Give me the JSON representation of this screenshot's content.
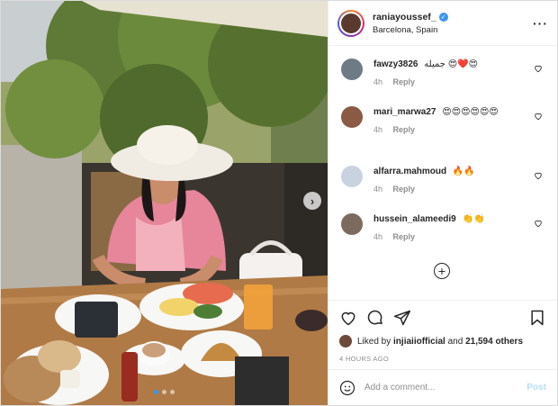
{
  "post": {
    "username": "raniayoussef_",
    "verified_icon": "verified-badge-icon",
    "location": "Barcelona, Spain",
    "more_icon": "more-options-icon",
    "avatar_color": "#5a3a2e"
  },
  "photo": {
    "description_icon": "post-photo",
    "next_icon": "chevron-right-icon",
    "carousel_count": 3,
    "carousel_active": 0
  },
  "comments": [
    {
      "user": "fawzy3826",
      "text": "جميله 😍❤️😍",
      "time": "4h",
      "reply": "Reply",
      "avatar_color": "#6e7a86"
    },
    {
      "user": "mari_marwa27",
      "text": "😍😍😍😍😍😍",
      "time": "4h",
      "reply": "Reply",
      "avatar_color": "#8a5a44"
    },
    {
      "user": "alfarra.mahmoud",
      "text": "🔥🔥",
      "time": "4h",
      "reply": "Reply",
      "avatar_color": "#c9d3df"
    },
    {
      "user": "hussein_alameedi9",
      "text": "👏👏",
      "time": "4h",
      "reply": "Reply",
      "avatar_color": "#7d6a5e"
    }
  ],
  "load_more_icon": "plus-circle-icon",
  "actions": {
    "like_icon": "heart-icon",
    "comment_icon": "comment-bubble-icon",
    "share_icon": "paper-plane-icon",
    "save_icon": "bookmark-icon"
  },
  "likes": {
    "prefix": "Liked by",
    "user": "injiaiiofficial",
    "conj": "and",
    "count": "21,594 others"
  },
  "time_ago": "4 HOURS AGO",
  "add_comment": {
    "placeholder": "Add a comment...",
    "post_label": "Post",
    "emoji_icon": "smiley-icon"
  },
  "colors": {
    "accent": "#3897f0",
    "post_disabled": "#b2dffc",
    "muted": "#8e8e8e"
  }
}
